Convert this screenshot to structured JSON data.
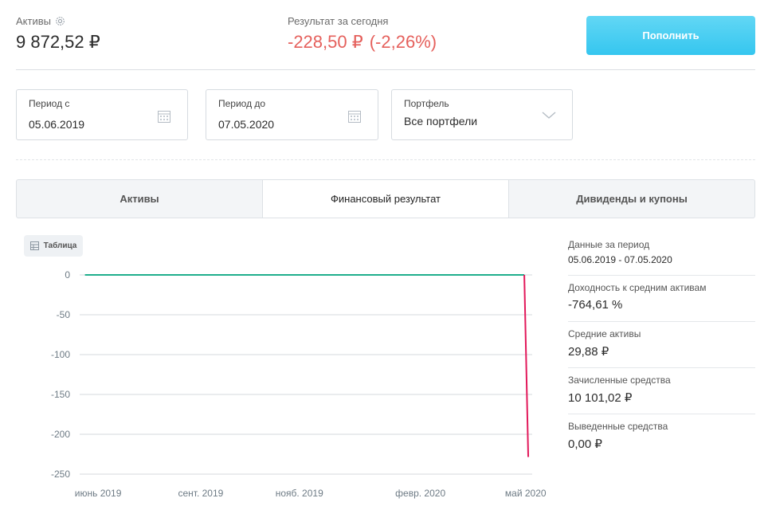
{
  "summary": {
    "assets_label": "Активы",
    "assets_value": "9 872,52 ₽",
    "result_label": "Результат за сегодня",
    "result_value": "-228,50 ₽",
    "result_percent": "(-2,26%)",
    "topup_label": "Пополнить"
  },
  "filters": {
    "period_from_label": "Период с",
    "period_from_value": "05.06.2019",
    "period_to_label": "Период до",
    "period_to_value": "07.05.2020",
    "portfolio_label": "Портфель",
    "portfolio_value": "Все портфели"
  },
  "tabs": [
    {
      "label": "Активы",
      "active": false
    },
    {
      "label": "Финансовый результат",
      "active": true
    },
    {
      "label": "Дивиденды и купоны",
      "active": false
    }
  ],
  "table_button_label": "Таблица",
  "stats": [
    {
      "label": "Данные за период",
      "value": "05.06.2019 - 07.05.2020"
    },
    {
      "label": "Доходность к средним активам",
      "value": "-764,61 %"
    },
    {
      "label": "Средние активы",
      "value": "29,88 ₽"
    },
    {
      "label": "Зачисленные средства",
      "value": "10 101,02 ₽"
    },
    {
      "label": "Выведенные средства",
      "value": "0,00 ₽"
    }
  ],
  "colors": {
    "accent": "#35c6ef",
    "negative": "#e5605c",
    "line_positive": "#1fae8c",
    "line_negative": "#e2185a"
  },
  "chart_data": {
    "type": "line",
    "x_tick_labels": [
      "июнь 2019",
      "сент. 2019",
      "нояб. 2019",
      "февр. 2020",
      "май 2020"
    ],
    "y_ticks": [
      0,
      -50,
      -100,
      -150,
      -200,
      -250
    ],
    "ylim": [
      -250,
      0
    ],
    "grid": true,
    "series": [
      {
        "x": [
          "2019-06-05",
          "2020-05-04",
          "2020-05-07"
        ],
        "y": [
          0,
          0,
          -228.5
        ]
      }
    ]
  }
}
